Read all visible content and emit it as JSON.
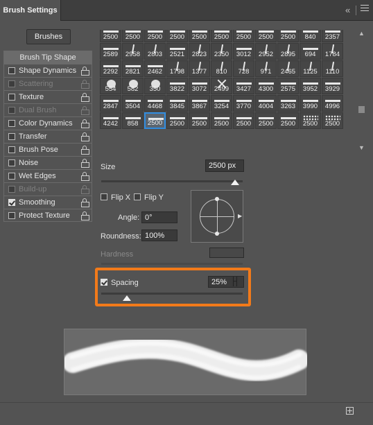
{
  "panel": {
    "tab_title": "Brush Settings",
    "collapse_icon": "double-chevron-left-icon",
    "menu_icon": "hamburger-menu-icon"
  },
  "brushes_button": "Brushes",
  "sidebar": {
    "header": "Brush Tip Shape",
    "items": [
      {
        "label": "Shape Dynamics",
        "checked": false,
        "enabled": true
      },
      {
        "label": "Scattering",
        "checked": false,
        "enabled": false
      },
      {
        "label": "Texture",
        "checked": false,
        "enabled": true
      },
      {
        "label": "Dual Brush",
        "checked": false,
        "enabled": false
      },
      {
        "label": "Color Dynamics",
        "checked": false,
        "enabled": true
      },
      {
        "label": "Transfer",
        "checked": false,
        "enabled": true
      },
      {
        "label": "Brush Pose",
        "checked": false,
        "enabled": true
      },
      {
        "label": "Noise",
        "checked": false,
        "enabled": true
      },
      {
        "label": "Wet Edges",
        "checked": false,
        "enabled": true
      },
      {
        "label": "Build-up",
        "checked": false,
        "enabled": false
      },
      {
        "label": "Smoothing",
        "checked": true,
        "enabled": true
      },
      {
        "label": "Protect Texture",
        "checked": false,
        "enabled": true
      }
    ]
  },
  "brush_grid": {
    "rows": [
      [
        "2500",
        "2500",
        "2500",
        "2500",
        "2500",
        "2500",
        "2500",
        "2500",
        "2500",
        "840",
        "2357"
      ],
      [
        "2589",
        "2958",
        "2803",
        "2521",
        "2823",
        "2350",
        "3012",
        "2952",
        "2895",
        "694",
        "1784"
      ],
      [
        "2292",
        "2821",
        "2462",
        "1798",
        "1377",
        "810",
        "728",
        "971",
        "2465",
        "1125",
        "1110"
      ],
      [
        "554",
        "582",
        "350",
        "3822",
        "3072",
        "2499",
        "3427",
        "4300",
        "2575",
        "3952",
        "3929"
      ],
      [
        "2847",
        "3504",
        "4468",
        "3845",
        "3867",
        "3254",
        "3770",
        "4004",
        "3263",
        "3990",
        "4996"
      ],
      [
        "4242",
        "858",
        "2500",
        "2500",
        "2500",
        "2500",
        "2500",
        "2500",
        "2500",
        "2500",
        "2500"
      ]
    ],
    "selected": "2500"
  },
  "size": {
    "label": "Size",
    "value": "2500 px",
    "reset_icon": "reset-icon"
  },
  "flip_x": {
    "label": "Flip X",
    "checked": false
  },
  "flip_y": {
    "label": "Flip Y",
    "checked": false
  },
  "angle": {
    "label": "Angle:",
    "value": "0°"
  },
  "roundness": {
    "label": "Roundness:",
    "value": "100%"
  },
  "hardness": {
    "label": "Hardness",
    "value": ""
  },
  "spacing": {
    "label": "Spacing",
    "checked": true,
    "value": "25%",
    "level": 0.25
  },
  "new_preset_icon": "plus-square-icon",
  "colors": {
    "highlight": "#f27a1a",
    "selection": "#2f8ce0"
  }
}
